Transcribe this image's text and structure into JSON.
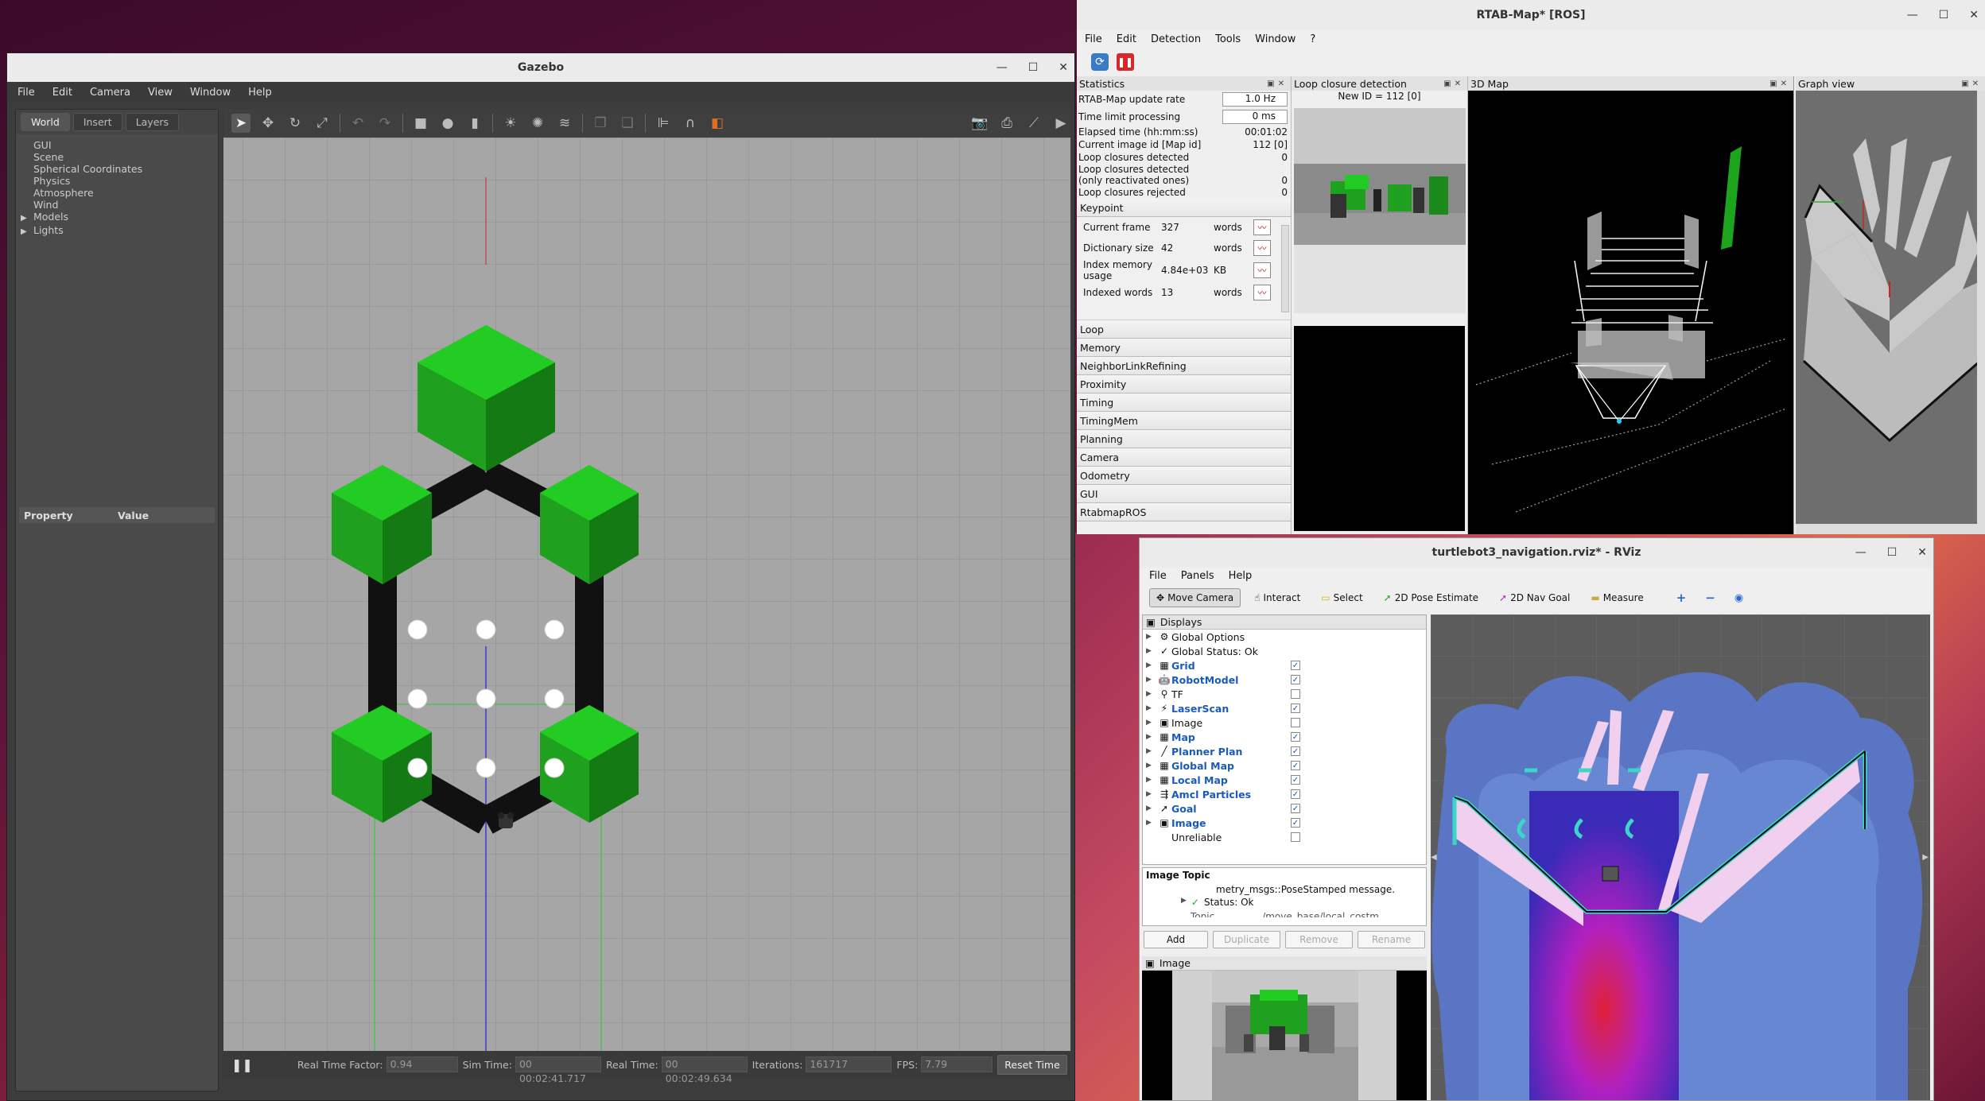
{
  "gazebo": {
    "title": "Gazebo",
    "menu": [
      "File",
      "Edit",
      "Camera",
      "View",
      "Window",
      "Help"
    ],
    "tabs": [
      "World",
      "Insert",
      "Layers"
    ],
    "tree": [
      "GUI",
      "Scene",
      "Spherical Coordinates",
      "Physics",
      "Atmosphere",
      "Wind"
    ],
    "tree_expandable": [
      "Models",
      "Lights"
    ],
    "property_header": "Property",
    "value_header": "Value",
    "status": {
      "rtf_label": "Real Time Factor:",
      "rtf": "0.94",
      "sim_label": "Sim Time:",
      "sim": "00 00:02:41.717",
      "real_label": "Real Time:",
      "real": "00 00:02:49.634",
      "iter_label": "Iterations:",
      "iter": "161717",
      "fps_label": "FPS:",
      "fps": "7.79",
      "reset": "Reset Time"
    }
  },
  "rtab": {
    "title": "RTAB-Map* [ROS]",
    "menu": [
      "File",
      "Edit",
      "Detection",
      "Tools",
      "Window",
      "?"
    ],
    "stats_title": "Statistics",
    "update_rate_label": "RTAB-Map update rate",
    "update_rate": "1.0 Hz",
    "time_limit_label": "Time limit processing",
    "time_limit": "0 ms",
    "rows": [
      {
        "label": "Elapsed time (hh:mm:ss)",
        "value": "00:01:02"
      },
      {
        "label": "Current image id [Map id]",
        "value": "112 [0]"
      },
      {
        "label": "Loop closures detected",
        "value": "0"
      },
      {
        "label": "Loop closures detected",
        "value": ""
      },
      {
        "label": "(only reactivated ones)",
        "value": "0"
      },
      {
        "label": "Loop closures rejected",
        "value": "0"
      }
    ],
    "keypoint_title": "Keypoint",
    "keypoints": [
      {
        "label": "Current frame",
        "value": "327",
        "unit": "words"
      },
      {
        "label": "Dictionary size",
        "value": "42",
        "unit": "words"
      },
      {
        "label": "Index memory usage",
        "value": "4.84e+03",
        "unit": "KB"
      },
      {
        "label": "Indexed words",
        "value": "13",
        "unit": "words"
      }
    ],
    "groups": [
      "Loop",
      "Memory",
      "NeighborLinkRefining",
      "Proximity",
      "Timing",
      "TimingMem",
      "Planning",
      "Camera",
      "Odometry",
      "GUI",
      "RtabmapROS"
    ],
    "loop_title": "Loop closure detection",
    "new_id": "New ID = 112 [0]",
    "map3d_title": "3D Map",
    "graph_title": "Graph view"
  },
  "rviz": {
    "title": "turtlebot3_navigation.rviz* - RViz",
    "menu": [
      "File",
      "Panels",
      "Help"
    ],
    "tools": [
      {
        "label": "Move Camera",
        "icon": "move-camera-icon",
        "glyph": "✥"
      },
      {
        "label": "Interact",
        "icon": "interact-icon",
        "glyph": "☝"
      },
      {
        "label": "Select",
        "icon": "select-icon",
        "glyph": "▭"
      },
      {
        "label": "2D Pose Estimate",
        "icon": "pose-estimate-icon",
        "glyph": "➚"
      },
      {
        "label": "2D Nav Goal",
        "icon": "nav-goal-icon",
        "glyph": "➚"
      },
      {
        "label": "Measure",
        "icon": "measure-icon",
        "glyph": "▬"
      }
    ],
    "displays_title": "Displays",
    "displays": [
      {
        "label": "Global Options",
        "bold": false,
        "check": null,
        "icon": "⚙"
      },
      {
        "label": "Global Status: Ok",
        "bold": false,
        "check": null,
        "icon": "✓"
      },
      {
        "label": "Grid",
        "bold": true,
        "check": true,
        "icon": "▦"
      },
      {
        "label": "RobotModel",
        "bold": true,
        "check": true,
        "icon": "🤖"
      },
      {
        "label": "TF",
        "bold": false,
        "check": false,
        "icon": "⚲"
      },
      {
        "label": "LaserScan",
        "bold": true,
        "check": true,
        "icon": "⚡"
      },
      {
        "label": "Image",
        "bold": false,
        "check": false,
        "icon": "▣"
      },
      {
        "label": "Map",
        "bold": true,
        "check": true,
        "icon": "▦"
      },
      {
        "label": "Planner Plan",
        "bold": true,
        "check": true,
        "icon": "╱"
      },
      {
        "label": "Global Map",
        "bold": true,
        "check": true,
        "icon": "▦"
      },
      {
        "label": "Local Map",
        "bold": true,
        "check": true,
        "icon": "▦"
      },
      {
        "label": "Amcl Particles",
        "bold": true,
        "check": true,
        "icon": "⇶"
      },
      {
        "label": "Goal",
        "bold": true,
        "check": true,
        "icon": "➚"
      },
      {
        "label": "Image",
        "bold": true,
        "check": true,
        "icon": "▣"
      },
      {
        "label": "Unreliable",
        "bold": false,
        "check": false,
        "icon": ""
      }
    ],
    "image_topic_title": "Image Topic",
    "msg_line": "metry_msgs::PoseStamped message.",
    "status_line": "Status: Ok",
    "topic_line_a": "Topic",
    "topic_line_b": "/move_base/local_costm",
    "buttons": [
      "Add",
      "Duplicate",
      "Remove",
      "Rename"
    ],
    "image_panel_title": "Image"
  }
}
